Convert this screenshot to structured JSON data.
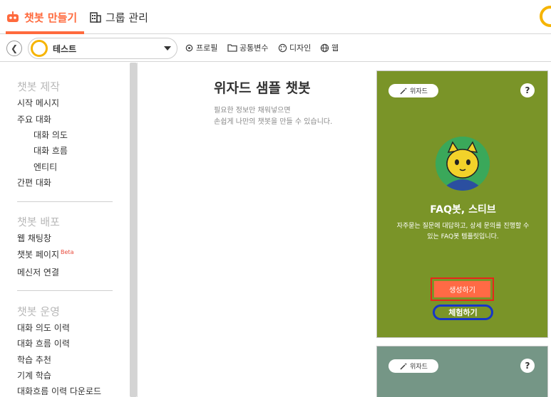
{
  "top_tabs": {
    "chatbot_builder": "챗봇 만들기",
    "group_management": "그룹 관리"
  },
  "toolbar": {
    "bot_name": "테스트",
    "profile": "프로필",
    "common_variables": "공통변수",
    "design": "디자인",
    "web": "웹"
  },
  "sidebar": {
    "section_build": "챗봇 제작",
    "start_message": "시작 메시지",
    "main_dialog": "주요 대화",
    "intent": "대화 의도",
    "flow": "대화 흐름",
    "entity": "엔티티",
    "simple_dialog": "간편 대화",
    "section_deploy": "챗봇 배포",
    "web_chat": "웹 채팅창",
    "bot_page": "챗봇 페이지",
    "beta": "Beta",
    "messenger_connect": "메신저 연결",
    "section_operate": "챗봇 운영",
    "intent_history": "대화 의도 이력",
    "flow_history": "대화 흐름 이력",
    "learning_recommend": "학습 추천",
    "machine_learning": "기계 학습",
    "flow_history_download": "대화흐름 이력 다운로드"
  },
  "main": {
    "title": "위자드 샘플 챗봇",
    "desc_line1": "필요한 정보만 채워넣으면",
    "desc_line2": "손쉽게 나만의 챗봇을 만들 수 있습니다."
  },
  "cards": [
    {
      "badge": "위자드",
      "help": "?",
      "name": "FAQ봇, 스티브",
      "desc_line1": "자주묻는 질문에 대답하고, 상세 문의를 진행할 수",
      "desc_line2": "있는 FAQ봇 템플릿입니다.",
      "create_label": "생성하기",
      "try_label": "체험하기",
      "bg_color": "#7a9428"
    },
    {
      "badge": "위자드",
      "help": "?",
      "bg_color": "#759686"
    }
  ],
  "colors": {
    "accent": "#ff6a3d",
    "highlight_red": "#e8251a",
    "highlight_blue": "#1636c8"
  }
}
